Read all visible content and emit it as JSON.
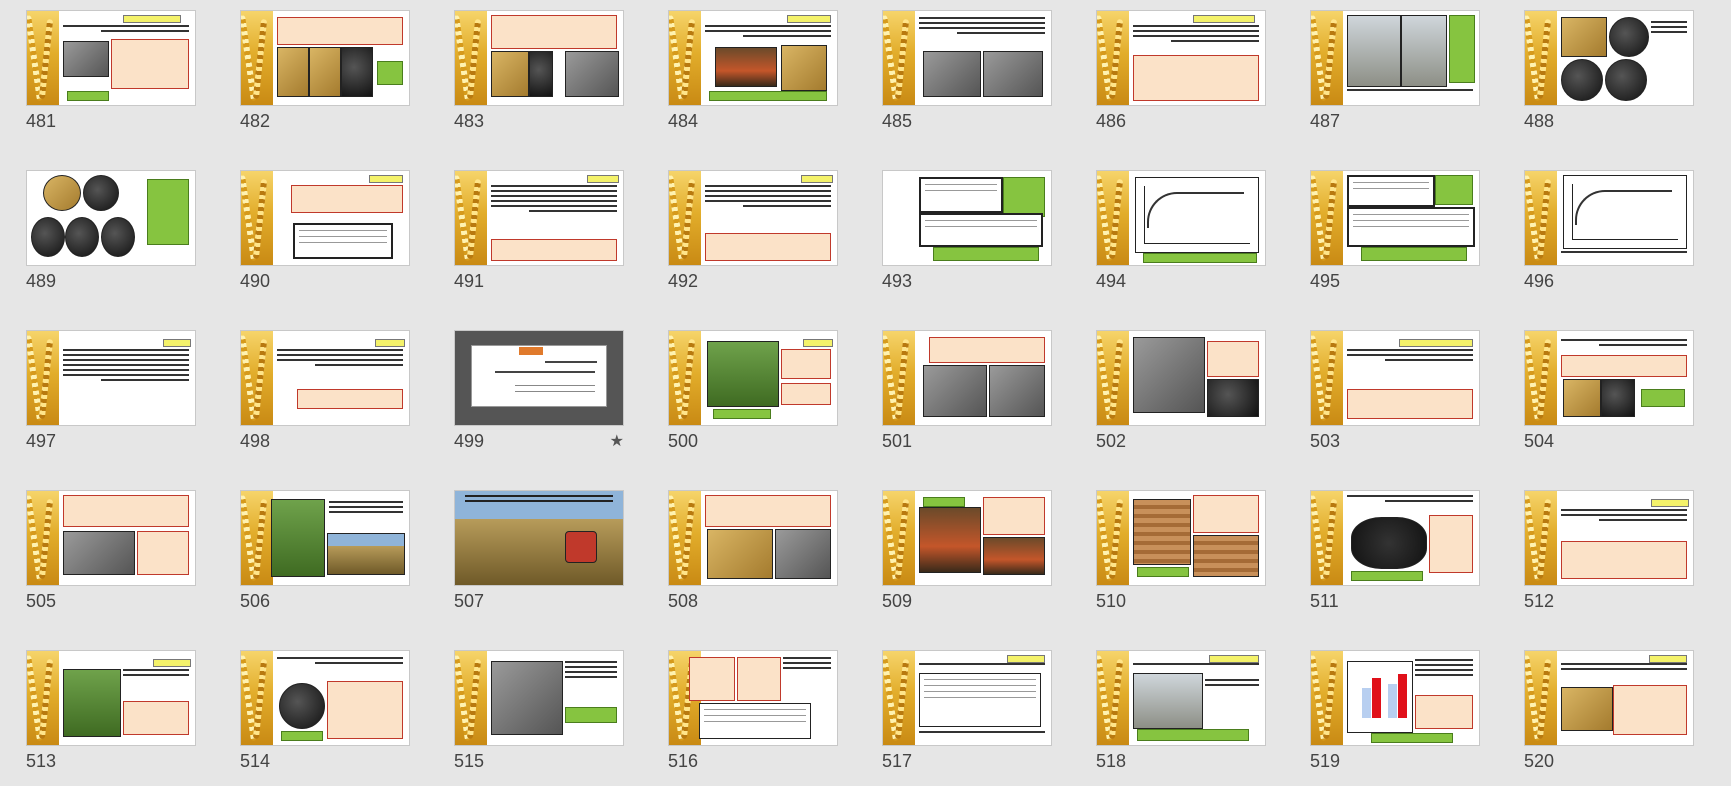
{
  "slides": [
    {
      "number": "481",
      "starred": false
    },
    {
      "number": "482",
      "starred": false
    },
    {
      "number": "483",
      "starred": false
    },
    {
      "number": "484",
      "starred": false
    },
    {
      "number": "485",
      "starred": false
    },
    {
      "number": "486",
      "starred": false
    },
    {
      "number": "487",
      "starred": false
    },
    {
      "number": "488",
      "starred": false
    },
    {
      "number": "489",
      "starred": false
    },
    {
      "number": "490",
      "starred": false
    },
    {
      "number": "491",
      "starred": false
    },
    {
      "number": "492",
      "starred": false
    },
    {
      "number": "493",
      "starred": false
    },
    {
      "number": "494",
      "starred": false
    },
    {
      "number": "495",
      "starred": false
    },
    {
      "number": "496",
      "starred": false
    },
    {
      "number": "497",
      "starred": false
    },
    {
      "number": "498",
      "starred": false
    },
    {
      "number": "499",
      "starred": true
    },
    {
      "number": "500",
      "starred": false
    },
    {
      "number": "501",
      "starred": false
    },
    {
      "number": "502",
      "starred": false
    },
    {
      "number": "503",
      "starred": false
    },
    {
      "number": "504",
      "starred": false
    },
    {
      "number": "505",
      "starred": false
    },
    {
      "number": "506",
      "starred": false
    },
    {
      "number": "507",
      "starred": false
    },
    {
      "number": "508",
      "starred": false
    },
    {
      "number": "509",
      "starred": false
    },
    {
      "number": "510",
      "starred": false
    },
    {
      "number": "511",
      "starred": false
    },
    {
      "number": "512",
      "starred": false
    },
    {
      "number": "513",
      "starred": false
    },
    {
      "number": "514",
      "starred": false
    },
    {
      "number": "515",
      "starred": false
    },
    {
      "number": "516",
      "starred": false
    },
    {
      "number": "517",
      "starred": false
    },
    {
      "number": "518",
      "starred": false
    },
    {
      "number": "519",
      "starred": false
    },
    {
      "number": "520",
      "starred": false
    }
  ],
  "star_glyph": "★",
  "colors": {
    "accent_red": "#c0392b",
    "accent_green": "#86c440",
    "bar_red": "#e0101a",
    "bar_blue": "#b8cff0"
  }
}
